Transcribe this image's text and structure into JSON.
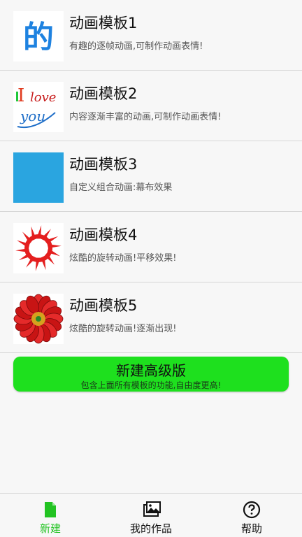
{
  "templates": [
    {
      "title": "动画模板1",
      "desc": "有趣的逐帧动画,可制作动画表情!",
      "thumb": "de-character-image"
    },
    {
      "title": "动画模板2",
      "desc": "内容逐渐丰富的动画,可制作动画表情!",
      "thumb": "i-love-you-image"
    },
    {
      "title": "动画模板3",
      "desc": "自定义组合动画:幕布效果",
      "thumb": "blue-square-image"
    },
    {
      "title": "动画模板4",
      "desc": "炫酷的旋转动画!平移效果!",
      "thumb": "red-gear-ring-image"
    },
    {
      "title": "动画模板5",
      "desc": "炫酷的旋转动画!逐渐出现!",
      "thumb": "red-flower-image"
    }
  ],
  "new_advanced": {
    "title": "新建高级版",
    "subtitle": "包含上面所有模板的功能,自由度更高!"
  },
  "bottom_nav": [
    {
      "label": "新建",
      "icon": "new-file-icon",
      "active": true
    },
    {
      "label": "我的作品",
      "icon": "gallery-icon",
      "active": false
    },
    {
      "label": "帮助",
      "icon": "help-icon",
      "active": false
    }
  ],
  "colors": {
    "accent_green": "#1ee01e",
    "active_tab": "#22c322",
    "thumb_blue": "#2aa5e0",
    "thumb_red": "#e41f1f"
  }
}
